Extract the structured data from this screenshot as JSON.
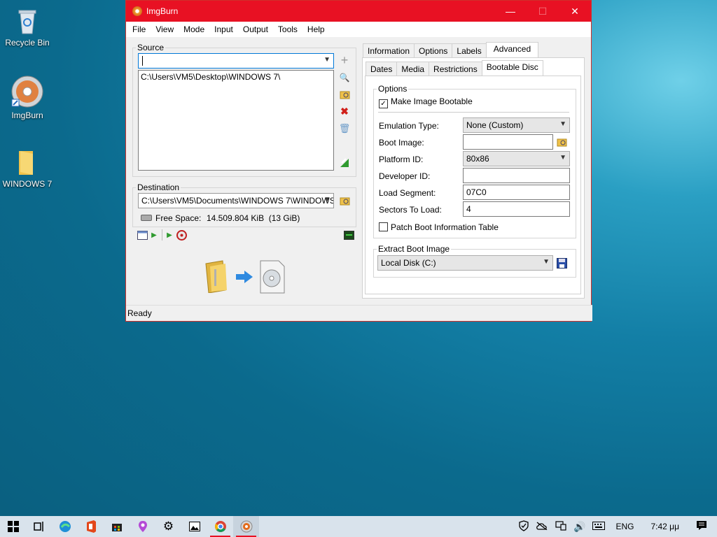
{
  "desktop": {
    "icons": [
      {
        "label": "Recycle Bin"
      },
      {
        "label": "ImgBurn"
      },
      {
        "label": "WINDOWS 7"
      }
    ]
  },
  "window": {
    "title": "ImgBurn",
    "accent": "#e81123"
  },
  "menu": [
    "File",
    "View",
    "Mode",
    "Input",
    "Output",
    "Tools",
    "Help"
  ],
  "source": {
    "label": "Source",
    "input_value": "",
    "list_items": [
      "C:\\Users\\VM5\\Desktop\\WINDOWS 7\\"
    ]
  },
  "destination": {
    "label": "Destination",
    "value": "C:\\Users\\VM5\\Documents\\WINDOWS 7\\WINDOWS",
    "free_space_label": "Free Space:",
    "free_space_value": "14.509.804 KiB  (13 GiB)"
  },
  "tabs_top": [
    "Information",
    "Options",
    "Labels",
    "Advanced"
  ],
  "tabs_sub": [
    "Dates",
    "Media",
    "Restrictions",
    "Bootable Disc"
  ],
  "options": {
    "legend": "Options",
    "make_bootable_label": "Make Image Bootable",
    "make_bootable_checked": true,
    "emulation_label": "Emulation Type:",
    "emulation_value": "None (Custom)",
    "boot_image_label": "Boot Image:",
    "boot_image_value": "",
    "platform_label": "Platform ID:",
    "platform_value": "80x86",
    "developer_label": "Developer ID:",
    "developer_value": "",
    "load_segment_label": "Load Segment:",
    "load_segment_value": "07C0",
    "sectors_label": "Sectors To Load:",
    "sectors_value": "4",
    "patch_label": "Patch Boot Information Table",
    "patch_checked": false
  },
  "extract": {
    "legend": "Extract Boot Image",
    "drive_value": "Local Disk (C:)"
  },
  "status": "Ready",
  "tray": {
    "language": "ENG",
    "time": "7:42 μμ"
  }
}
